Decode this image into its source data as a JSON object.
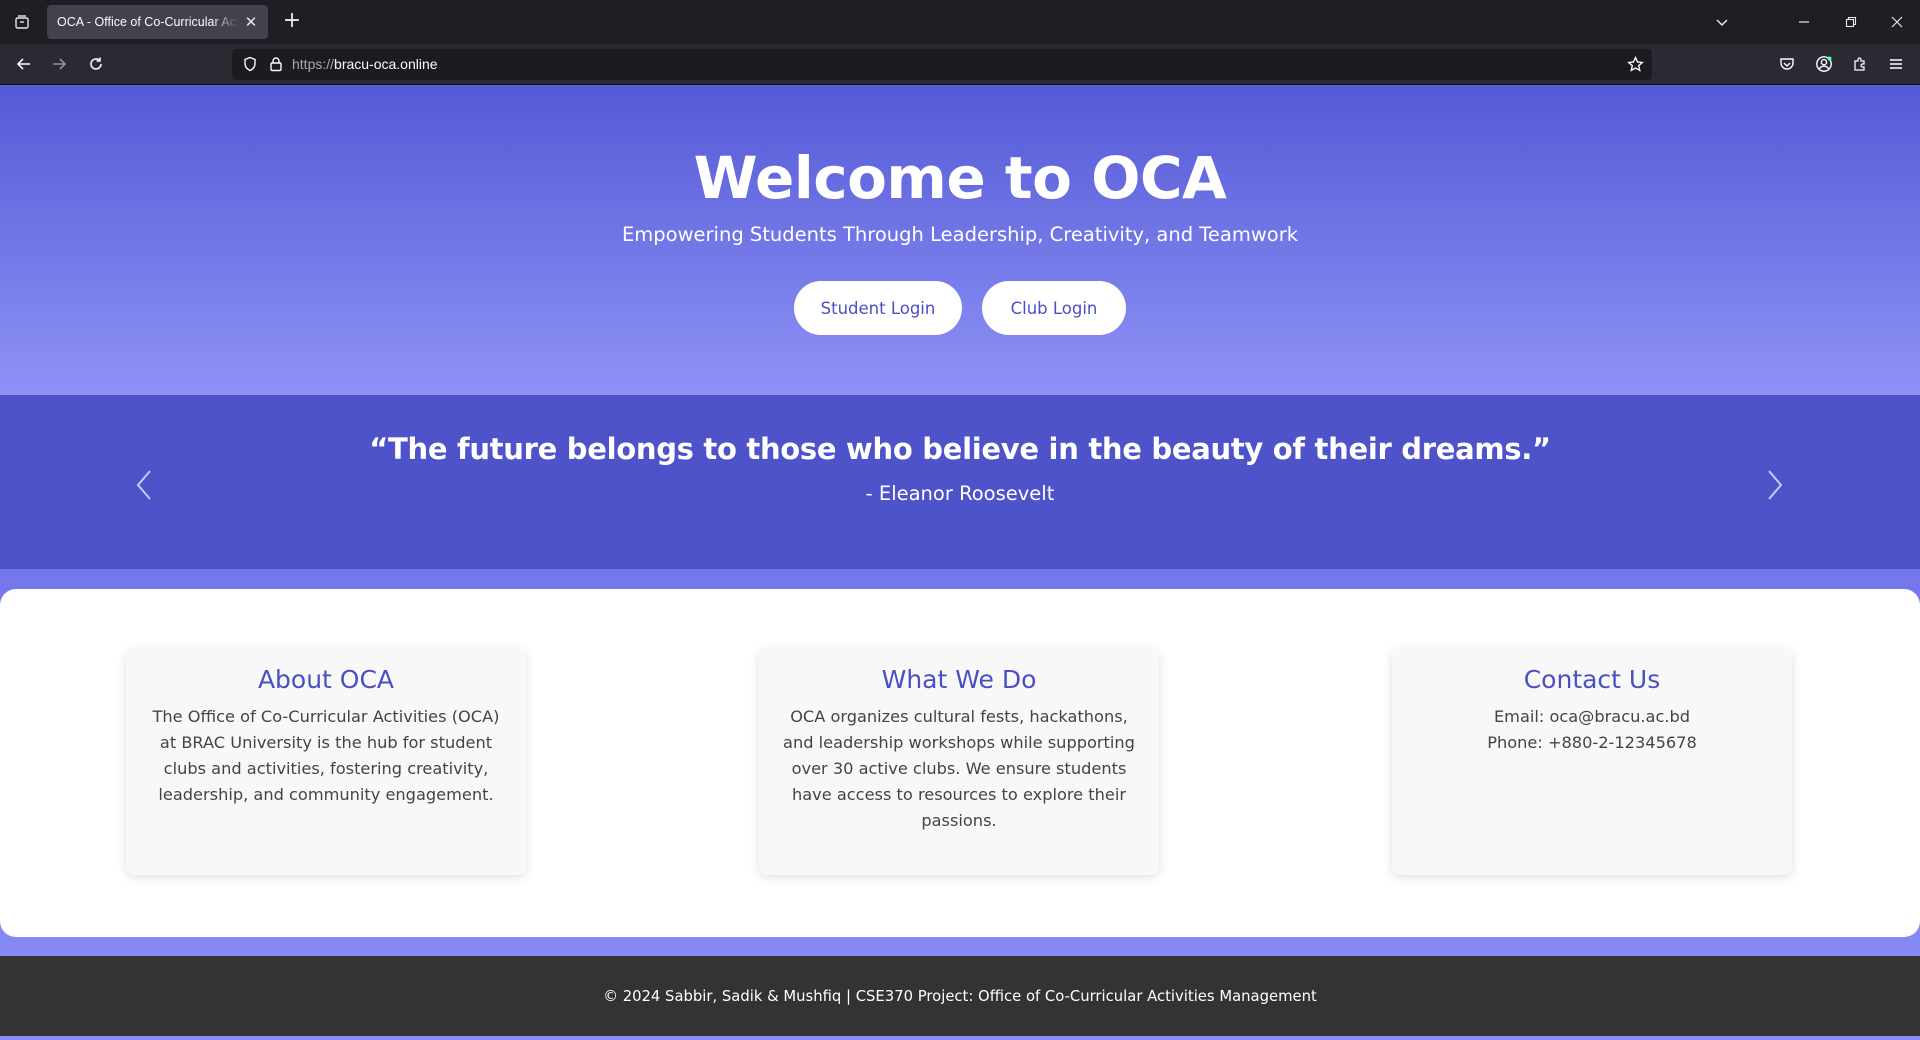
{
  "browser": {
    "tab": {
      "title": "OCA - Office of Co-Curricular Activities Management"
    },
    "url": {
      "scheme": "https://",
      "host": "bracu-oca.online"
    }
  },
  "hero": {
    "title": "Welcome to OCA",
    "subtitle": "Empowering Students Through Leadership, Creativity, and Teamwork",
    "buttons": {
      "student_login": "Student Login",
      "club_login": "Club Login"
    }
  },
  "quote": {
    "text": "“The future belongs to those who believe in the beauty of their dreams.”",
    "author": "- Eleanor Roosevelt"
  },
  "cards": {
    "about": {
      "title": "About OCA",
      "body": "The Office of Co-Curricular Activities (OCA) at BRAC University is the hub for student clubs and activities, fostering creativity, leadership, and community engagement."
    },
    "what": {
      "title": "What We Do",
      "body": "OCA organizes cultural fests, hackathons, and leadership workshops while supporting over 30 active clubs. We ensure students have access to resources to explore their passions."
    },
    "contact": {
      "title": "Contact Us",
      "email": "Email: oca@bracu.ac.bd",
      "phone": "Phone: +880-2-12345678"
    }
  },
  "footer": {
    "text": "© 2024 Sabbir, Sadik & Mushfiq | CSE370 Project: Office of Co-Curricular Activities Management"
  },
  "colors": {
    "accent": "#4a4fc4",
    "hero_top": "#555ad6",
    "hero_bottom": "#8e92f6",
    "quote_band": "#4e53ca",
    "footer_bg": "#333333"
  }
}
